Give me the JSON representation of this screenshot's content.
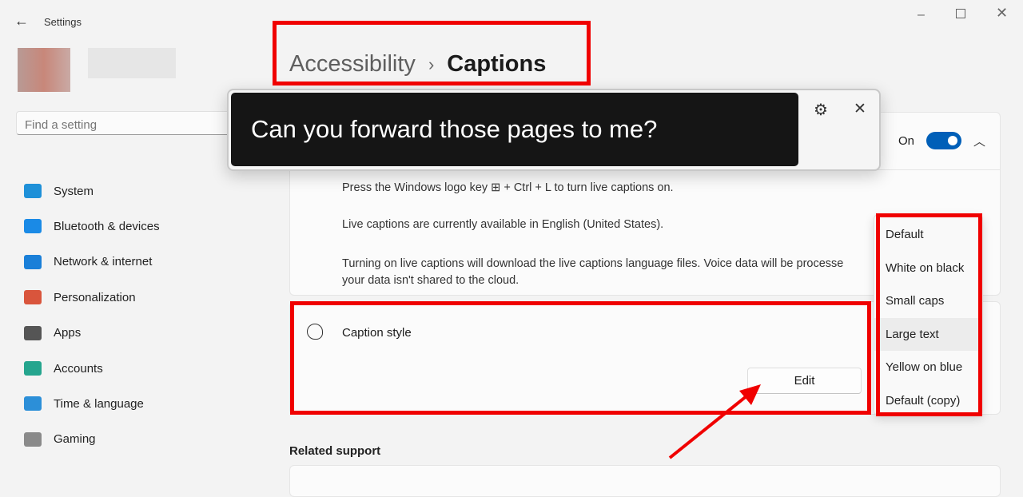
{
  "window": {
    "title": "Settings"
  },
  "search": {
    "placeholder": "Find a setting"
  },
  "sidebar": {
    "items": [
      {
        "label": "System",
        "color": "#1e90d8"
      },
      {
        "label": "Bluetooth & devices",
        "color": "#1a8ae6"
      },
      {
        "label": "Network & internet",
        "color": "#1a7fd8"
      },
      {
        "label": "Personalization",
        "color": "#d9553c"
      },
      {
        "label": "Apps",
        "color": "#555555"
      },
      {
        "label": "Accounts",
        "color": "#25a58e"
      },
      {
        "label": "Time & language",
        "color": "#2c8fd8"
      },
      {
        "label": "Gaming",
        "color": "#8a8a8a"
      }
    ]
  },
  "breadcrumb": {
    "parent": "Accessibility",
    "separator": "›",
    "current": "Captions"
  },
  "caption_overlay": {
    "text": "Can you forward those pages to me?"
  },
  "live_captions": {
    "toggle_label": "On",
    "toggle_on": true,
    "lines": [
      "Press the Windows logo key ⊞ + Ctrl + L to turn live captions on.",
      "Live captions are currently available in English (United States).",
      "Turning on live captions will download the live captions language files. Voice data will be processe",
      "your data isn't shared to the cloud."
    ]
  },
  "caption_style": {
    "label": "Caption style",
    "edit_label": "Edit"
  },
  "style_menu": {
    "options": [
      "Default",
      "White on black",
      "Small caps",
      "Large text",
      "Yellow on blue",
      "Default (copy)"
    ],
    "selected": "Large text"
  },
  "related": {
    "title": "Related support"
  },
  "colors": {
    "accent": "#005fb8",
    "highlight": "#f00000"
  }
}
